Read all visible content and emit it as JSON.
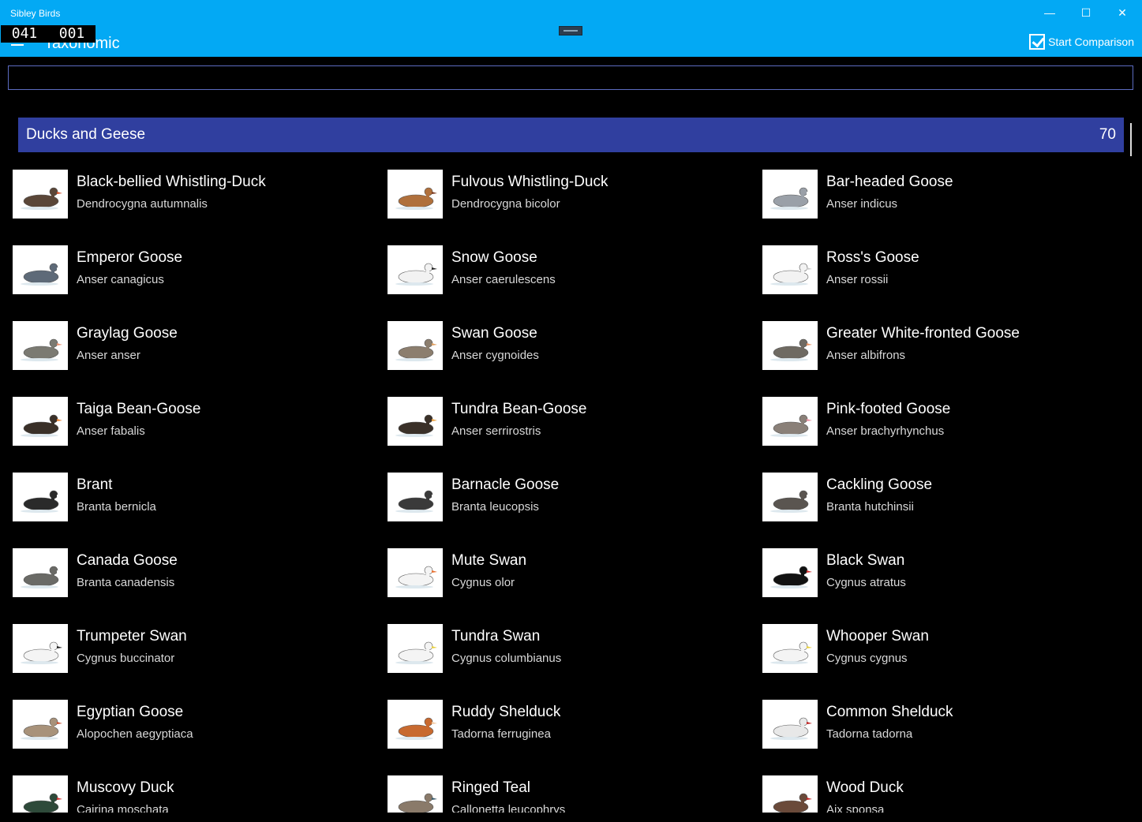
{
  "window": {
    "app_name": "Sibley Birds",
    "counter_left": "041",
    "counter_right": "001",
    "page_title": "Taxonomic",
    "minimize": "—",
    "maximize": "☐",
    "close": "✕"
  },
  "toolbar": {
    "compare_label": "Start Comparison"
  },
  "search": {
    "value": "",
    "placeholder": ""
  },
  "group": {
    "name": "Ducks and Geese",
    "count": "70"
  },
  "birds": [
    {
      "common": "Black-bellied Whistling-Duck",
      "latin": "Dendrocygna autumnalis"
    },
    {
      "common": "Fulvous Whistling-Duck",
      "latin": "Dendrocygna bicolor"
    },
    {
      "common": "Bar-headed Goose",
      "latin": "Anser indicus"
    },
    {
      "common": "Emperor Goose",
      "latin": "Anser canagicus"
    },
    {
      "common": "Snow Goose",
      "latin": "Anser caerulescens"
    },
    {
      "common": "Ross's Goose",
      "latin": "Anser rossii"
    },
    {
      "common": "Graylag Goose",
      "latin": "Anser anser"
    },
    {
      "common": "Swan Goose",
      "latin": "Anser cygnoides"
    },
    {
      "common": "Greater White-fronted Goose",
      "latin": "Anser albifrons"
    },
    {
      "common": "Taiga Bean-Goose",
      "latin": "Anser fabalis"
    },
    {
      "common": "Tundra Bean-Goose",
      "latin": "Anser serrirostris"
    },
    {
      "common": "Pink-footed Goose",
      "latin": "Anser brachyrhynchus"
    },
    {
      "common": "Brant",
      "latin": "Branta bernicla"
    },
    {
      "common": "Barnacle Goose",
      "latin": "Branta leucopsis"
    },
    {
      "common": "Cackling Goose",
      "latin": "Branta hutchinsii"
    },
    {
      "common": "Canada Goose",
      "latin": "Branta canadensis"
    },
    {
      "common": "Mute Swan",
      "latin": "Cygnus olor"
    },
    {
      "common": "Black Swan",
      "latin": "Cygnus atratus"
    },
    {
      "common": "Trumpeter Swan",
      "latin": "Cygnus buccinator"
    },
    {
      "common": "Tundra Swan",
      "latin": "Cygnus columbianus"
    },
    {
      "common": "Whooper Swan",
      "latin": "Cygnus cygnus"
    },
    {
      "common": "Egyptian Goose",
      "latin": "Alopochen aegyptiaca"
    },
    {
      "common": "Ruddy Shelduck",
      "latin": "Tadorna ferruginea"
    },
    {
      "common": "Common Shelduck",
      "latin": "Tadorna tadorna"
    },
    {
      "common": "Muscovy Duck",
      "latin": "Cairina moschata"
    },
    {
      "common": "Ringed Teal",
      "latin": "Callonetta leucophrys"
    },
    {
      "common": "Wood Duck",
      "latin": "Aix sponsa"
    }
  ],
  "thumb_colors": {
    "body": [
      "#5a4638",
      "#b0703c",
      "#9aa0a8",
      "#5e6a78",
      "#f2f2f2",
      "#f2f2f2",
      "#7b7a72",
      "#8c7e6e",
      "#6f6a62",
      "#3a3028",
      "#3a3028",
      "#8a8078",
      "#2a2a2a",
      "#3a3a3a",
      "#5a5550",
      "#6a6a66",
      "#f4f4f4",
      "#111111",
      "#f4f4f4",
      "#f4f4f4",
      "#f4f4f4",
      "#a8927a",
      "#c86a30",
      "#e8e8e8",
      "#2e4a3a",
      "#8a7a6a",
      "#6a4a3a"
    ],
    "accent": [
      "#d0502a",
      "#7a3a20",
      "#ffffff",
      "#ffffff",
      "#222222",
      "#c8c8c8",
      "#e89070",
      "#e0a060",
      "#e89060",
      "#e88030",
      "#e8a040",
      "#e890a0",
      "#ffffff",
      "#ffffff",
      "#ffffff",
      "#ffffff",
      "#e87030",
      "#d03030",
      "#222222",
      "#e8d040",
      "#e8d040",
      "#c85030",
      "#f2c8a0",
      "#c02020",
      "#d03030",
      "#3a5a6a",
      "#c02020"
    ]
  }
}
